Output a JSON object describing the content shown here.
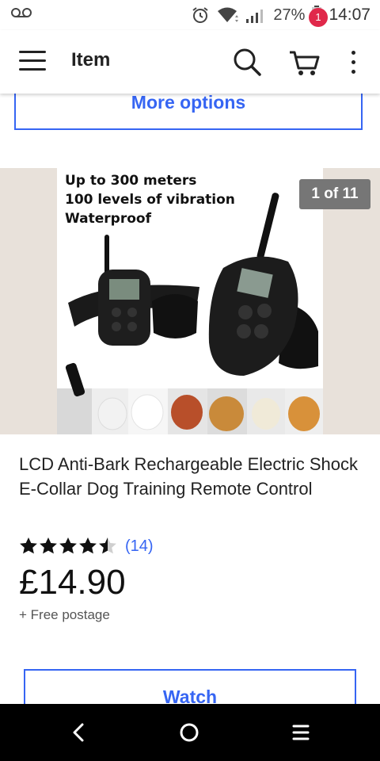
{
  "status_bar": {
    "battery": "27%",
    "time": "14:07"
  },
  "app_bar": {
    "title": "Item",
    "cart_count": "1"
  },
  "more_options_label": "More options",
  "gallery": {
    "image_text": [
      "Up to 300 meters",
      "100 levels of vibration",
      "Waterproof"
    ],
    "counter": "1 of 11"
  },
  "product": {
    "title": "LCD Anti-Bark Rechargeable Electric Shock E-Collar Dog Training Remote Control",
    "rating": 4.5,
    "review_count": "(14)",
    "price": "£14.90",
    "shipping": "+ Free postage"
  },
  "watch_label": "Watch",
  "colors": {
    "accent_blue": "#3665f3",
    "badge_red": "#e0284a",
    "gallery_bg": "#e8e1da",
    "counter_bg": "#767676"
  },
  "icons": [
    "voicemail-icon",
    "alarm-icon",
    "wifi-icon",
    "signal-icon",
    "battery-icon",
    "menu-icon",
    "search-icon",
    "cart-icon",
    "overflow-menu-icon",
    "star-icon",
    "back-icon",
    "home-icon",
    "recents-icon"
  ]
}
